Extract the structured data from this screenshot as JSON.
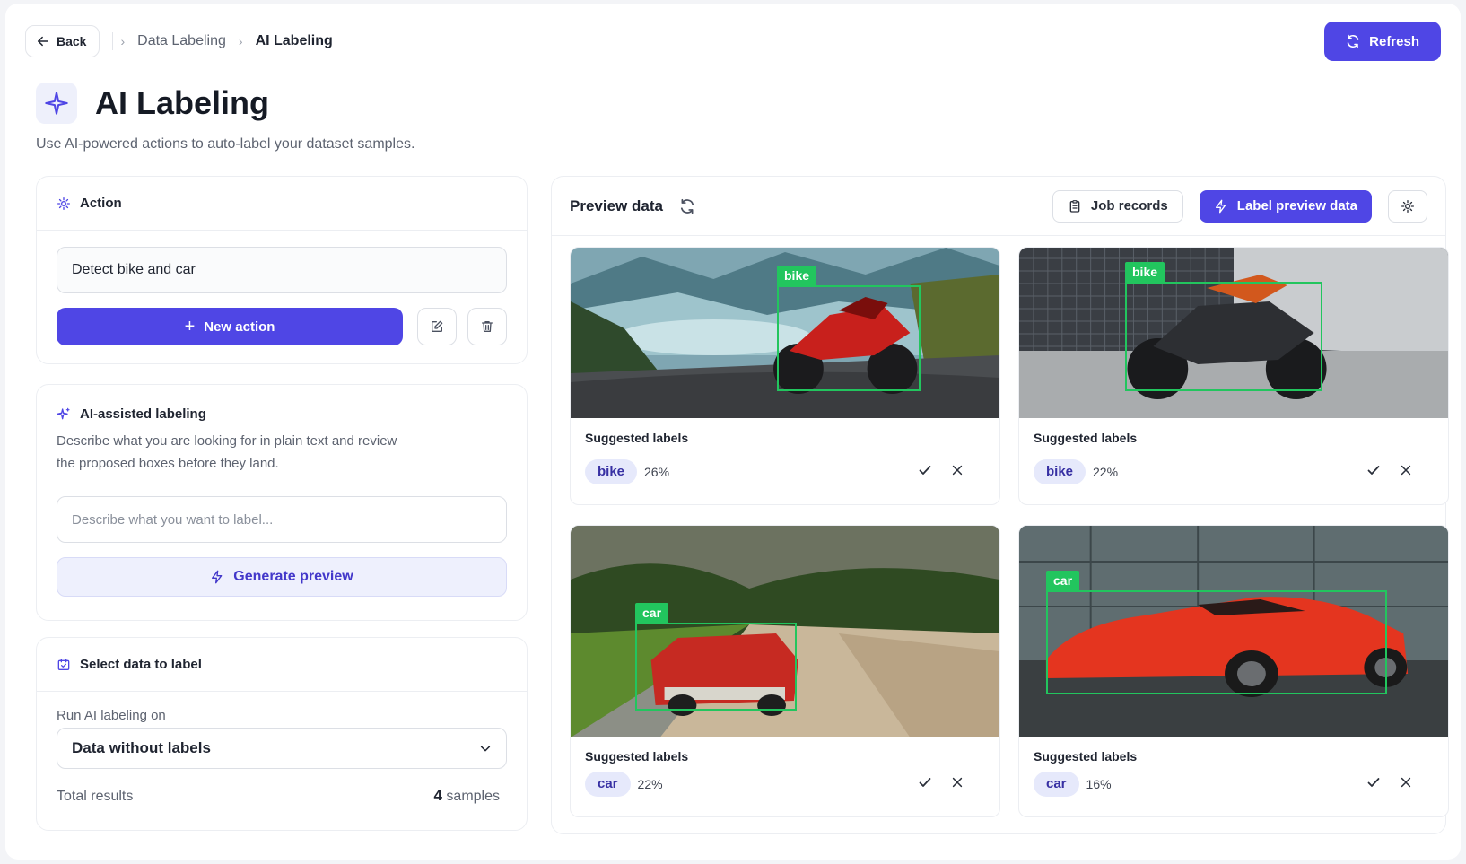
{
  "topbar": {
    "back_label": "Back",
    "breadcrumb": [
      "Data Labeling",
      "AI Labeling"
    ],
    "refresh_label": "Refresh"
  },
  "header": {
    "title": "AI Labeling",
    "subtitle": "Use AI-powered actions to auto-label your dataset samples."
  },
  "action_card": {
    "title": "Action",
    "current_action": "Detect bike and car",
    "new_action_label": "New action"
  },
  "ai_card": {
    "title": "AI-assisted labeling",
    "description": "Describe what you are looking for in plain text and review the proposed boxes before they land.",
    "input_placeholder": "Describe what you want to label...",
    "generate_label": "Generate preview"
  },
  "select_card": {
    "title": "Select data to label",
    "run_on_label": "Run AI labeling on",
    "selected_option": "Data without labels",
    "total_label": "Total results",
    "total_count": "4",
    "total_unit": "samples"
  },
  "preview": {
    "title": "Preview data",
    "job_records_label": "Job records",
    "label_preview_label": "Label preview data",
    "suggested_title": "Suggested labels",
    "samples": [
      {
        "tag": "bike",
        "label": "bike",
        "confidence": "26%"
      },
      {
        "tag": "bike",
        "label": "bike",
        "confidence": "22%"
      },
      {
        "tag": "car",
        "label": "car",
        "confidence": "22%"
      },
      {
        "tag": "car",
        "label": "car",
        "confidence": "16%"
      }
    ]
  },
  "colors": {
    "accent": "#4f46e5",
    "bbox": "#22c55e",
    "chip_bg": "#e6e9fb"
  }
}
